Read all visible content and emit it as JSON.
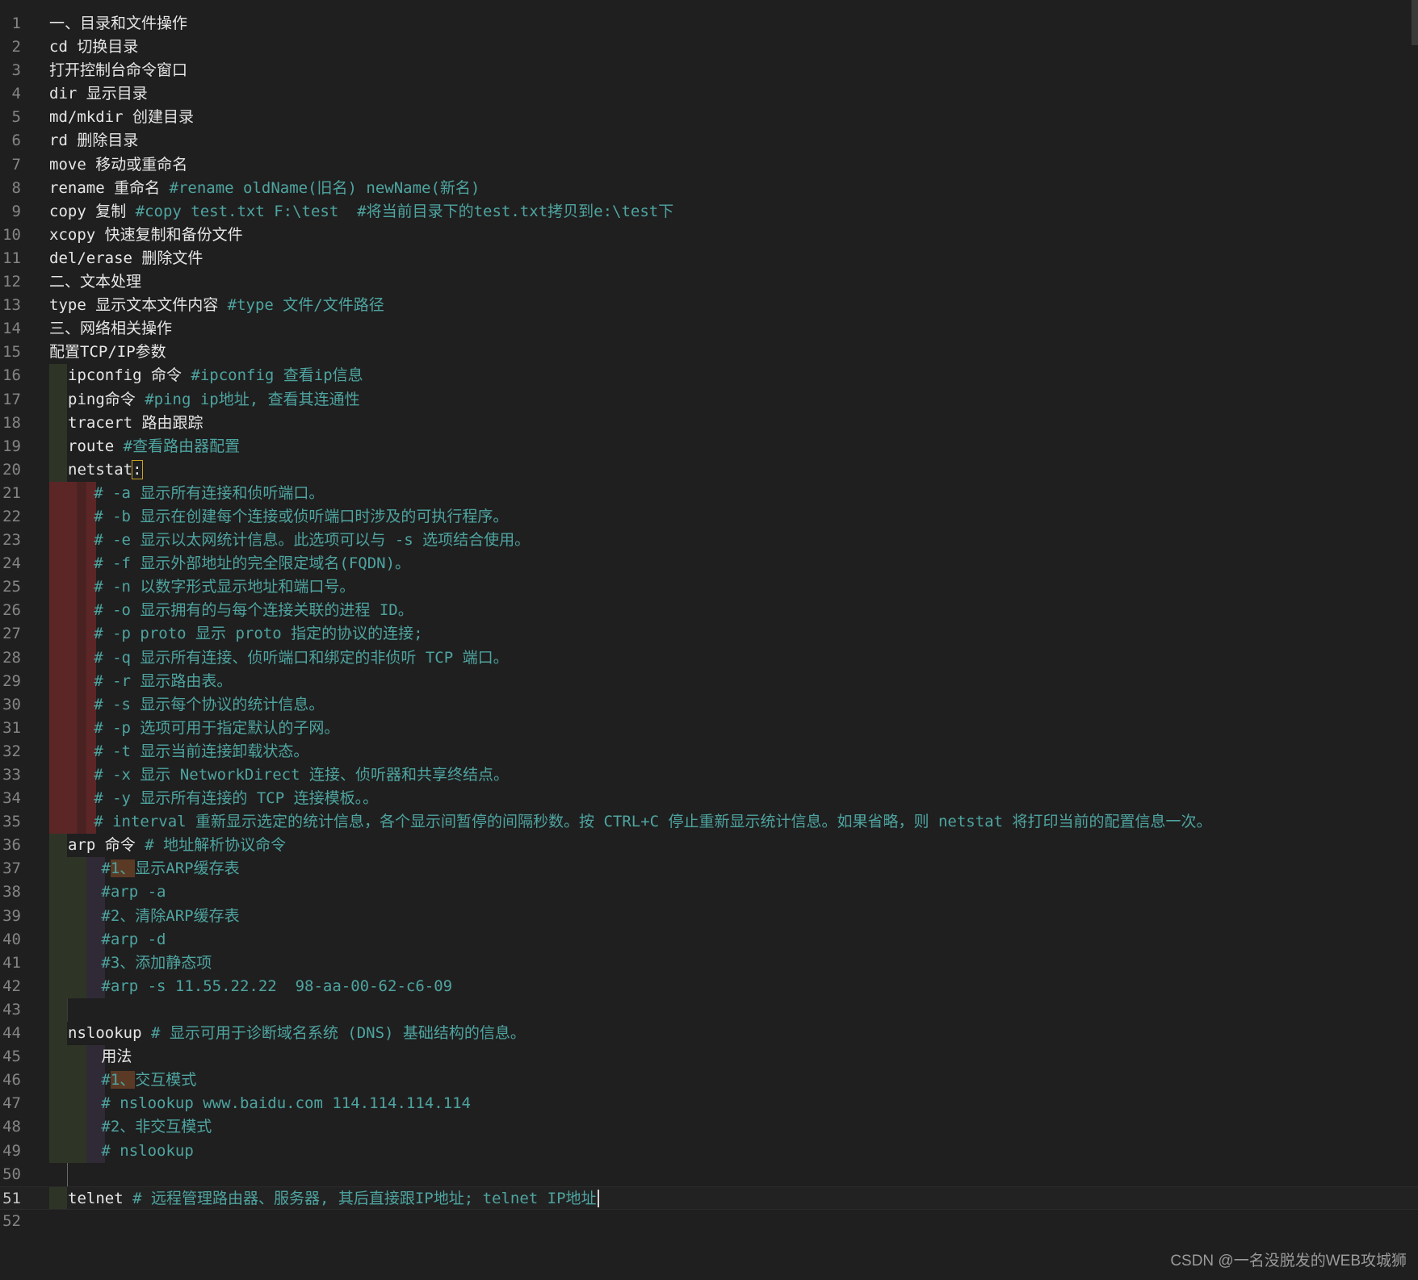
{
  "editor": {
    "lines": [
      {
        "n": "1",
        "code": "一、目录和文件操作",
        "comment": ""
      },
      {
        "n": "2",
        "code": "cd 切换目录",
        "comment": ""
      },
      {
        "n": "3",
        "code": "打开控制台命令窗口",
        "comment": ""
      },
      {
        "n": "4",
        "code": "dir 显示目录",
        "comment": ""
      },
      {
        "n": "5",
        "code": "md/mkdir 创建目录",
        "comment": ""
      },
      {
        "n": "6",
        "code": "rd 删除目录",
        "comment": ""
      },
      {
        "n": "7",
        "code": "move 移动或重命名",
        "comment": ""
      },
      {
        "n": "8",
        "code": "rename 重命名 ",
        "comment": "#rename oldName(旧名) newName(新名)"
      },
      {
        "n": "9",
        "code": "copy 复制 ",
        "comment": "#copy test.txt F:\\test  #将当前目录下的test.txt拷贝到e:\\test下"
      },
      {
        "n": "10",
        "code": "xcopy 快速复制和备份文件",
        "comment": ""
      },
      {
        "n": "11",
        "code": "del/erase 删除文件",
        "comment": ""
      },
      {
        "n": "12",
        "code": "二、文本处理",
        "comment": ""
      },
      {
        "n": "13",
        "code": "type 显示文本文件内容 ",
        "comment": "#type 文件/文件路径"
      },
      {
        "n": "14",
        "code": "三、网络相关操作",
        "comment": ""
      },
      {
        "n": "15",
        "code": "配置TCP/IP参数",
        "comment": ""
      },
      {
        "n": "16",
        "code": "ipconfig 命令 ",
        "comment": "#ipconfig 查看ip信息"
      },
      {
        "n": "17",
        "code": "ping命令 ",
        "comment": "#ping ip地址, 查看其连通性"
      },
      {
        "n": "18",
        "code": "tracert 路由跟踪",
        "comment": ""
      },
      {
        "n": "19",
        "code": "route ",
        "comment": "#查看路由器配置"
      },
      {
        "n": "20",
        "code": "netstat",
        "comment": ""
      },
      {
        "n": "21",
        "code": "",
        "comment": "# -a 显示所有连接和侦听端口。"
      },
      {
        "n": "22",
        "code": "",
        "comment": "# -b 显示在创建每个连接或侦听端口时涉及的可执行程序。"
      },
      {
        "n": "23",
        "code": "",
        "comment": "# -e 显示以太网统计信息。此选项可以与 -s 选项结合使用。"
      },
      {
        "n": "24",
        "code": "",
        "comment": "# -f 显示外部地址的完全限定域名(FQDN)。"
      },
      {
        "n": "25",
        "code": "",
        "comment": "# -n 以数字形式显示地址和端口号。"
      },
      {
        "n": "26",
        "code": "",
        "comment": "# -o 显示拥有的与每个连接关联的进程 ID。"
      },
      {
        "n": "27",
        "code": "",
        "comment": "# -p proto 显示 proto 指定的协议的连接;"
      },
      {
        "n": "28",
        "code": "",
        "comment": "# -q 显示所有连接、侦听端口和绑定的非侦听 TCP 端口。"
      },
      {
        "n": "29",
        "code": "",
        "comment": "# -r 显示路由表。"
      },
      {
        "n": "30",
        "code": "",
        "comment": "# -s 显示每个协议的统计信息。"
      },
      {
        "n": "31",
        "code": "",
        "comment": "# -p 选项可用于指定默认的子网。"
      },
      {
        "n": "32",
        "code": "",
        "comment": "# -t 显示当前连接卸载状态。"
      },
      {
        "n": "33",
        "code": "",
        "comment": "# -x 显示 NetworkDirect 连接、侦听器和共享终结点。"
      },
      {
        "n": "34",
        "code": "",
        "comment": "# -y 显示所有连接的 TCP 连接模板。。"
      },
      {
        "n": "35",
        "code": "",
        "comment": "# interval 重新显示选定的统计信息，各个显示间暂停的间隔秒数。按 CTRL+C 停止重新显示统计信息。如果省略，则 netstat 将打印当前的配置信息一次。"
      },
      {
        "n": "36",
        "code": "arp 命令 ",
        "comment": "# 地址解析协议命令"
      },
      {
        "n": "37",
        "code": "",
        "comment": "#1、显示ARP缓存表"
      },
      {
        "n": "38",
        "code": "",
        "comment": "#arp -a"
      },
      {
        "n": "39",
        "code": "",
        "comment": "#2、清除ARP缓存表"
      },
      {
        "n": "40",
        "code": "",
        "comment": "#arp -d"
      },
      {
        "n": "41",
        "code": "",
        "comment": "#3、添加静态项"
      },
      {
        "n": "42",
        "code": "",
        "comment": "#arp -s 11.55.22.22  98-aa-00-62-c6-09"
      },
      {
        "n": "43",
        "code": "",
        "comment": ""
      },
      {
        "n": "44",
        "code": "nslookup ",
        "comment": "# 显示可用于诊断域名系统 (DNS) 基础结构的信息。"
      },
      {
        "n": "45",
        "code": "用法",
        "comment": ""
      },
      {
        "n": "46",
        "code": "",
        "comment": "#1、交互模式"
      },
      {
        "n": "47",
        "code": "",
        "comment": "# nslookup www.baidu.com 114.114.114.114"
      },
      {
        "n": "48",
        "code": "",
        "comment": "#2、非交互模式"
      },
      {
        "n": "49",
        "code": "",
        "comment": "# nslookup"
      },
      {
        "n": "50",
        "code": "",
        "comment": ""
      },
      {
        "n": "51",
        "code": "telnet ",
        "comment": "# 远程管理路由器、服务器, 其后直接跟IP地址; telnet IP地址"
      },
      {
        "n": "52",
        "code": "",
        "comment": ""
      }
    ]
  },
  "watermark": "CSDN @一名没脱发的WEB攻城狮",
  "colors": {
    "background": "#1f1f1f",
    "comment": "#4ea4a0",
    "text": "#e6e6e6",
    "line_number": "#858585",
    "guide_red": "#5c2626",
    "guide_green": "#2e3526",
    "guide_purple": "#2f2a36"
  }
}
